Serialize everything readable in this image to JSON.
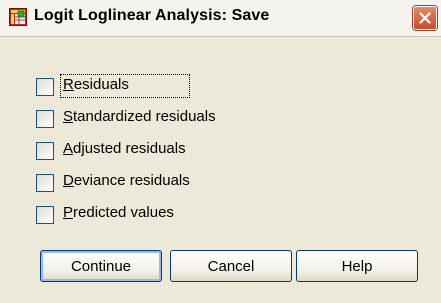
{
  "window": {
    "title": "Logit Loglinear Analysis: Save",
    "app_icon": "spss-table-icon",
    "close_icon": "close-icon"
  },
  "options": [
    {
      "mnemonic": "R",
      "rest": "esiduals",
      "checked": false
    },
    {
      "mnemonic": "S",
      "rest": "tandardized residuals",
      "checked": false
    },
    {
      "mnemonic": "A",
      "rest": "djusted residuals",
      "checked": false
    },
    {
      "mnemonic": "D",
      "rest": "eviance residuals",
      "checked": false
    },
    {
      "mnemonic": "P",
      "rest": "redicted values",
      "checked": false
    }
  ],
  "buttons": {
    "continue": "Continue",
    "cancel": "Cancel",
    "help": "Help"
  },
  "colors": {
    "dialog_bg": "#ece9d8",
    "close_button": "#c74c2e",
    "checkbox_border": "#1c5180"
  }
}
